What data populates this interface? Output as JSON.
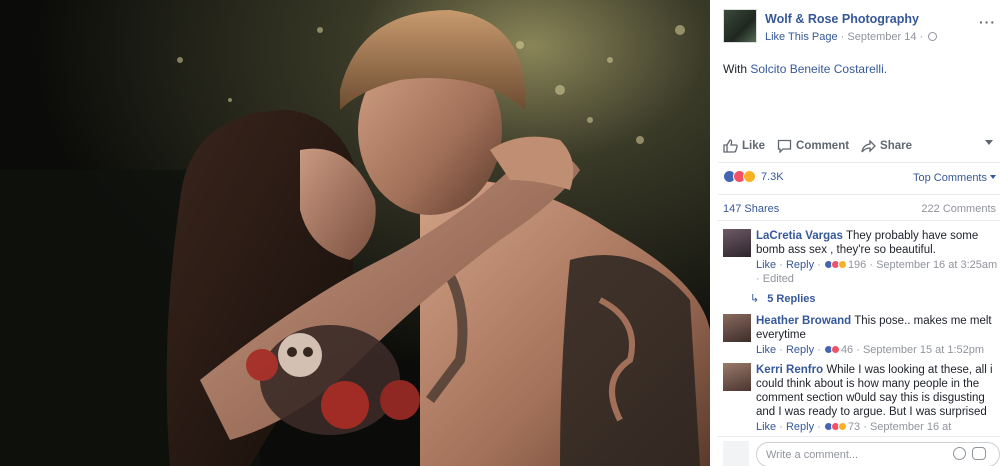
{
  "post": {
    "page_name": "Wolf & Rose Photography",
    "like_link": "Like This Page",
    "separator": "·",
    "date": "September 14",
    "with_prefix": "With",
    "tagged_person": "Solcito Beneite Costarelli.",
    "more_icon": "more-dots-icon"
  },
  "actions": {
    "like": "Like",
    "comment": "Comment",
    "share": "Share"
  },
  "reactions": {
    "count": "7.3K",
    "types": [
      "like",
      "love",
      "wow"
    ],
    "colors": {
      "like": "#4267b2",
      "love": "#f25268",
      "wow": "#f7b125"
    }
  },
  "sort": {
    "label": "Top Comments"
  },
  "stats": {
    "shares": "147 Shares",
    "comments": "222 Comments"
  },
  "comments": [
    {
      "name": "LaCretia Vargas",
      "text": "They probably have some bomb ass sex , they're so beautiful.",
      "like": "Like",
      "reply": "Reply",
      "reaction_count": "196",
      "date": "September 16 at 3:25am",
      "edited": "Edited",
      "replies": "5 Replies"
    },
    {
      "name": "Heather Browand",
      "text": "This pose.. makes me melt everytime",
      "like": "Like",
      "reply": "Reply",
      "reaction_count": "46",
      "date": "September 15 at 1:52pm"
    },
    {
      "name": "Kerri Renfro",
      "text": "While I was looking at these, all i could think about is how many people in the comment section w0uld say this is disgusting and I was ready to argue. But I was surprised",
      "like": "Like",
      "reply": "Reply",
      "reaction_count": "73",
      "date": "September 16 at"
    }
  ],
  "composer": {
    "placeholder": "Write a comment..."
  },
  "colors": {
    "link": "#365899",
    "meta": "#90949c",
    "text": "#1d2129"
  }
}
